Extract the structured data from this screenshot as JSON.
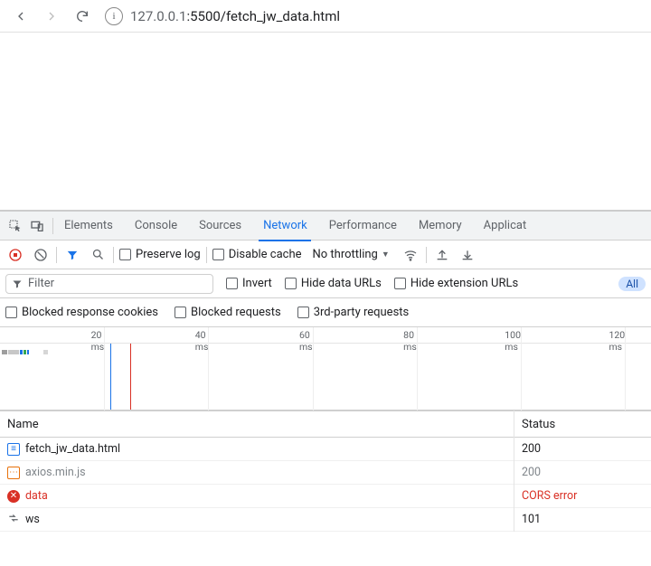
{
  "browser": {
    "url_gray_prefix": "127.0.0.1",
    "url_rest": ":5500/fetch_jw_data.html"
  },
  "devtools": {
    "tabs": [
      "Elements",
      "Console",
      "Sources",
      "Network",
      "Performance",
      "Memory",
      "Applicat"
    ],
    "active_tab_index": 3
  },
  "network_toolbar": {
    "preserve_log": "Preserve log",
    "disable_cache": "Disable cache",
    "throttling_label": "No throttling"
  },
  "filter_bar": {
    "filter_placeholder": "Filter",
    "invert": "Invert",
    "hide_data_urls": "Hide data URLs",
    "hide_extension_urls": "Hide extension URLs",
    "all_pill": "All"
  },
  "extra_filters": {
    "blocked_response_cookies": "Blocked response cookies",
    "blocked_requests": "Blocked requests",
    "third_party": "3rd-party requests"
  },
  "timeline_ticks": [
    "20 ms",
    "40 ms",
    "60 ms",
    "80 ms",
    "100 ms",
    "120 ms"
  ],
  "table": {
    "headers": {
      "name": "Name",
      "status": "Status"
    },
    "rows": [
      {
        "icon": "doc",
        "name": "fetch_jw_data.html",
        "status": "200",
        "style": "normal"
      },
      {
        "icon": "js",
        "name": "axios.min.js",
        "status": "200",
        "style": "gray"
      },
      {
        "icon": "err",
        "name": "data",
        "status": "CORS error",
        "style": "red"
      },
      {
        "icon": "ws",
        "name": "ws",
        "status": "101",
        "style": "normal"
      }
    ]
  }
}
